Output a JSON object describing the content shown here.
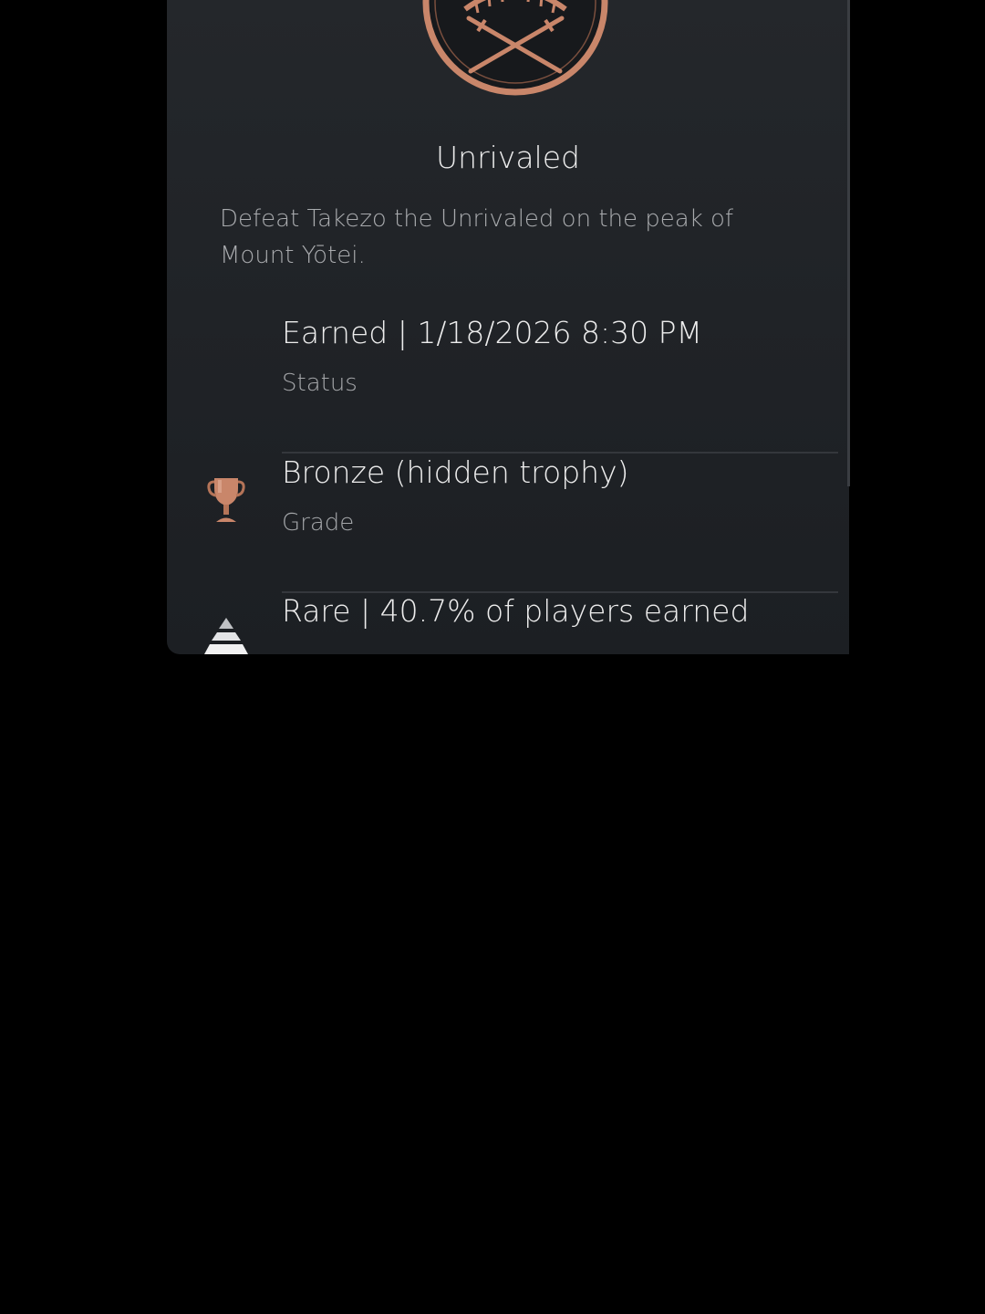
{
  "trophy": {
    "name": "Unrivaled",
    "description": "Defeat Takezo the Unrivaled on the peak of Mount Yōtei."
  },
  "details": {
    "status": {
      "value": "Earned | 1/18/2026  8:30 PM",
      "label": "Status"
    },
    "grade": {
      "value": "Bronze (hidden trophy)",
      "label": "Grade",
      "icon": "bronze-trophy-icon"
    },
    "rarity": {
      "value": "Rare | 40.7% of players earned",
      "icon": "rarity-pyramid-icon"
    }
  },
  "colors": {
    "bronze": "#c9866a",
    "background": "#000000",
    "panel": "#22252a"
  }
}
